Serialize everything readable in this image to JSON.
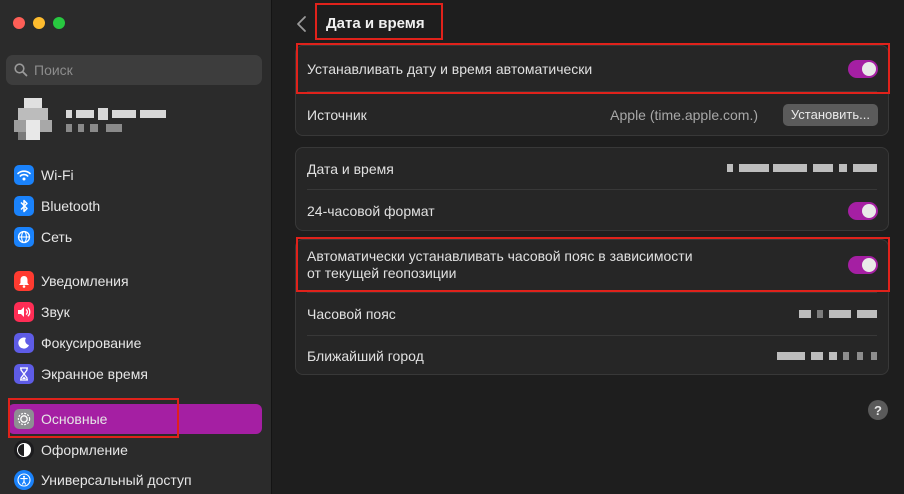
{
  "window": {
    "traffic_lights": [
      "#fe5f57",
      "#febc2e",
      "#28c840"
    ]
  },
  "sidebar": {
    "search_placeholder": "Поиск",
    "active_color": "#a51fa3",
    "items": [
      {
        "label": "Wi-Fi",
        "icon": "wifi-icon",
        "color": "#1a82fb"
      },
      {
        "label": "Bluetooth",
        "icon": "bluetooth-icon",
        "color": "#1a82fb"
      },
      {
        "label": "Сеть",
        "icon": "globe-icon",
        "color": "#1a82fb"
      },
      {
        "label": "Уведомления",
        "icon": "bell-icon",
        "color": "#ff3b30"
      },
      {
        "label": "Звук",
        "icon": "speaker-icon",
        "color": "#ff2d55"
      },
      {
        "label": "Фокусирование",
        "icon": "moon-icon",
        "color": "#5e5ce6"
      },
      {
        "label": "Экранное время",
        "icon": "hourglass-icon",
        "color": "#5e5ce6"
      },
      {
        "label": "Основные",
        "icon": "gear-icon",
        "color": "#8e8e93",
        "active": true
      },
      {
        "label": "Оформление",
        "icon": "appearance-icon",
        "color": "#1c1c1e"
      },
      {
        "label": "Универсальный доступ",
        "icon": "accessibility-icon",
        "color": "#1a82fb"
      }
    ]
  },
  "main": {
    "title": "Дата и время",
    "group1": {
      "auto_time_label": "Устанавливать дату и время автоматически",
      "auto_time_on": true,
      "source_label": "Источник",
      "source_value": "Apple (time.apple.com.)",
      "set_button": "Установить..."
    },
    "group2": {
      "datetime_label": "Дата и время",
      "format24_label": "24-часовой формат",
      "format24_on": true
    },
    "group3": {
      "auto_tz_label_line1": "Автоматически устанавливать часовой пояс в зависимости",
      "auto_tz_label_line2": "от текущей геопозиции",
      "auto_tz_on": true,
      "timezone_label": "Часовой пояс",
      "nearest_city_label": "Ближайший город"
    },
    "help": "?"
  }
}
